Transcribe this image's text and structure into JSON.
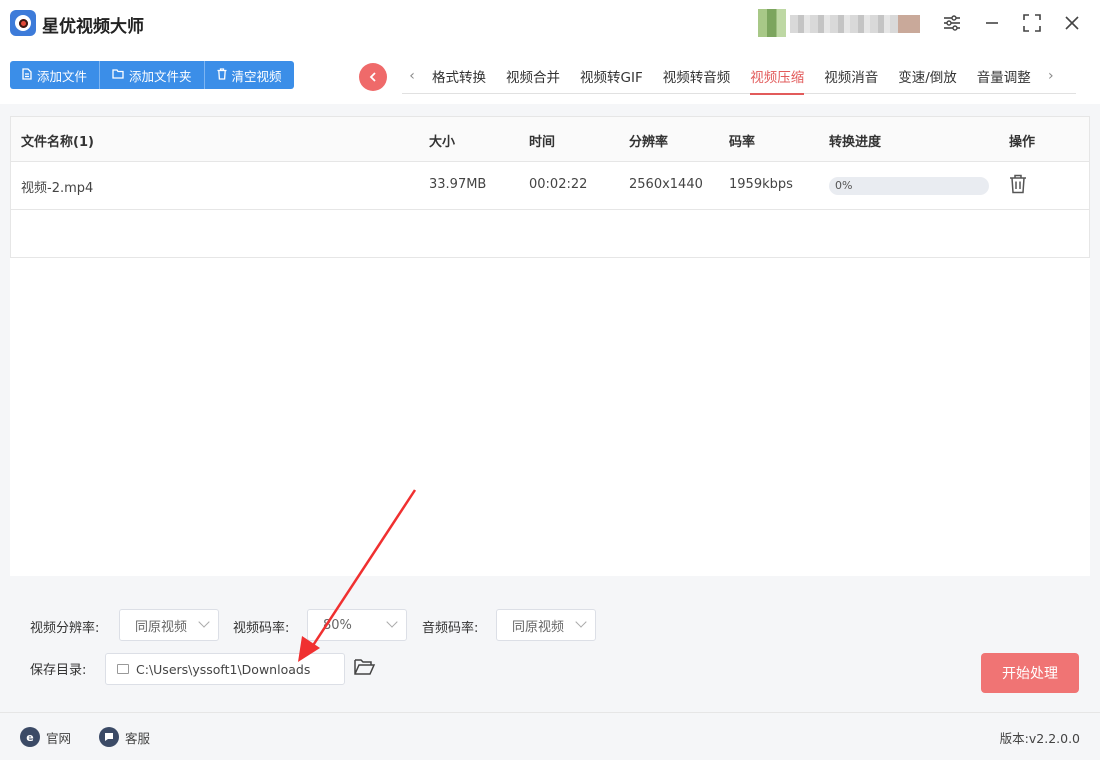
{
  "app": {
    "title": "星优视频大师"
  },
  "toolbar": {
    "add_file": "添加文件",
    "add_folder": "添加文件夹",
    "clear_videos": "清空视频"
  },
  "tabs": [
    "格式转换",
    "视频合并",
    "视频转GIF",
    "视频转音频",
    "视频压缩",
    "视频消音",
    "变速/倒放",
    "音量调整"
  ],
  "active_tab": "视频压缩",
  "table": {
    "headers": {
      "name": "文件名称(1)",
      "size": "大小",
      "time": "时间",
      "resolution": "分辨率",
      "bitrate": "码率",
      "progress": "转换进度",
      "action": "操作"
    },
    "rows": [
      {
        "name": "视频-2.mp4",
        "size": "33.97MB",
        "time": "00:02:22",
        "resolution": "2560x1440",
        "bitrate": "1959kbps",
        "progress": "0%",
        "progress_fraction": 0
      }
    ]
  },
  "settings": {
    "video_resolution_label": "视频分辨率:",
    "video_resolution_value": "同原视频",
    "video_bitrate_label": "视频码率:",
    "video_bitrate_value": "80%",
    "audio_bitrate_label": "音频码率:",
    "audio_bitrate_value": "同原视频",
    "save_dir_label": "保存目录:",
    "save_dir_value": "C:\\Users\\yssoft1\\Downloads",
    "start_button": "开始处理"
  },
  "footer": {
    "website": "官网",
    "support": "客服",
    "version": "版本:v2.2.0.0"
  },
  "colors": {
    "primary_blue": "#3b8ee8",
    "accent_red": "#e25b5b",
    "start_button": "#f07474",
    "annotation_arrow": "#f03030"
  }
}
